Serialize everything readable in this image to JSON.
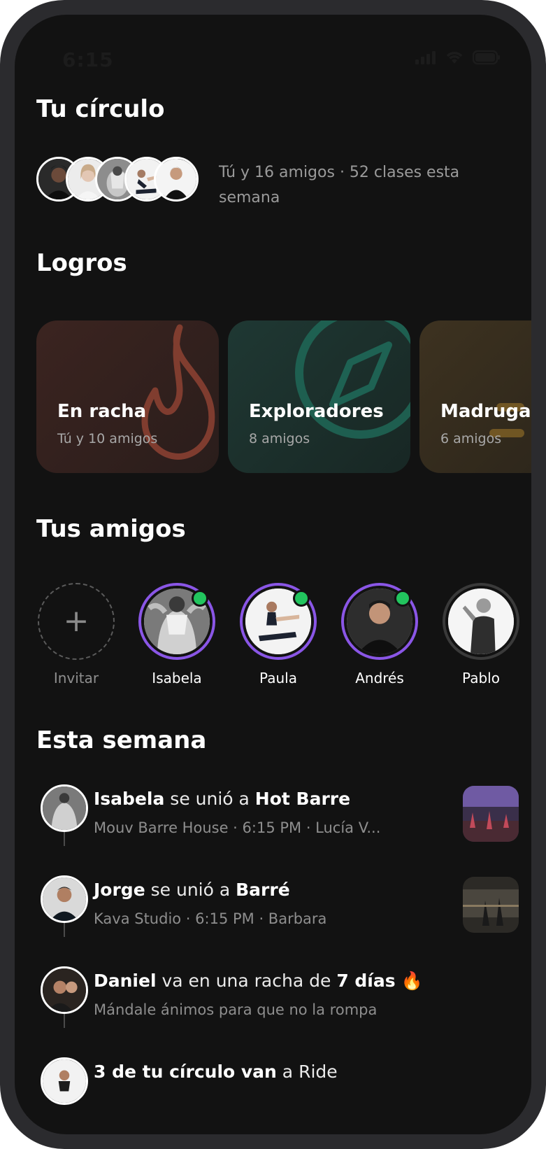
{
  "status_bar": {
    "time": "6:15"
  },
  "circle": {
    "heading": "Tu círculo",
    "summary": "Tú y 16 amigos · 52 clases esta semana"
  },
  "achievements": {
    "heading": "Logros",
    "items": [
      {
        "title": "En racha",
        "subtitle": "Tú y 10 amigos",
        "icon": "flame-icon",
        "color": "#c0573f"
      },
      {
        "title": "Exploradores",
        "subtitle": "8 amigos",
        "icon": "compass-icon",
        "color": "#1f7a66"
      },
      {
        "title": "Madrugadores",
        "subtitle": "6 amigos",
        "icon": "sun-icon",
        "color": "#a8741d"
      }
    ]
  },
  "friends": {
    "heading": "Tus amigos",
    "invite_label": "Invitar",
    "items": [
      {
        "name": "Isabela",
        "online": true
      },
      {
        "name": "Paula",
        "online": true
      },
      {
        "name": "Andrés",
        "online": true
      },
      {
        "name": "Pablo",
        "online": false
      }
    ]
  },
  "week": {
    "heading": "Esta semana",
    "items": [
      {
        "name": "Isabela",
        "action": " se unió a ",
        "target": "Hot Barre",
        "sub": "Mouv Barre House · 6:15 PM · Lucía V..."
      },
      {
        "name": "Jorge",
        "action": " se unió a ",
        "target": "Barré",
        "sub": "Kava Studio · 6:15 PM · Barbara"
      },
      {
        "name": "Daniel",
        "action": " va en una racha de ",
        "target": "7 días",
        "emoji": "🔥",
        "sub": "Mándale ánimos para que no la rompa"
      },
      {
        "name": "3 de tu círculo van",
        "action": " a ",
        "target": "Ride",
        "sub": ""
      }
    ]
  },
  "colors": {
    "accent": "#8a56e6",
    "online": "#22c55e",
    "background": "#121212"
  }
}
